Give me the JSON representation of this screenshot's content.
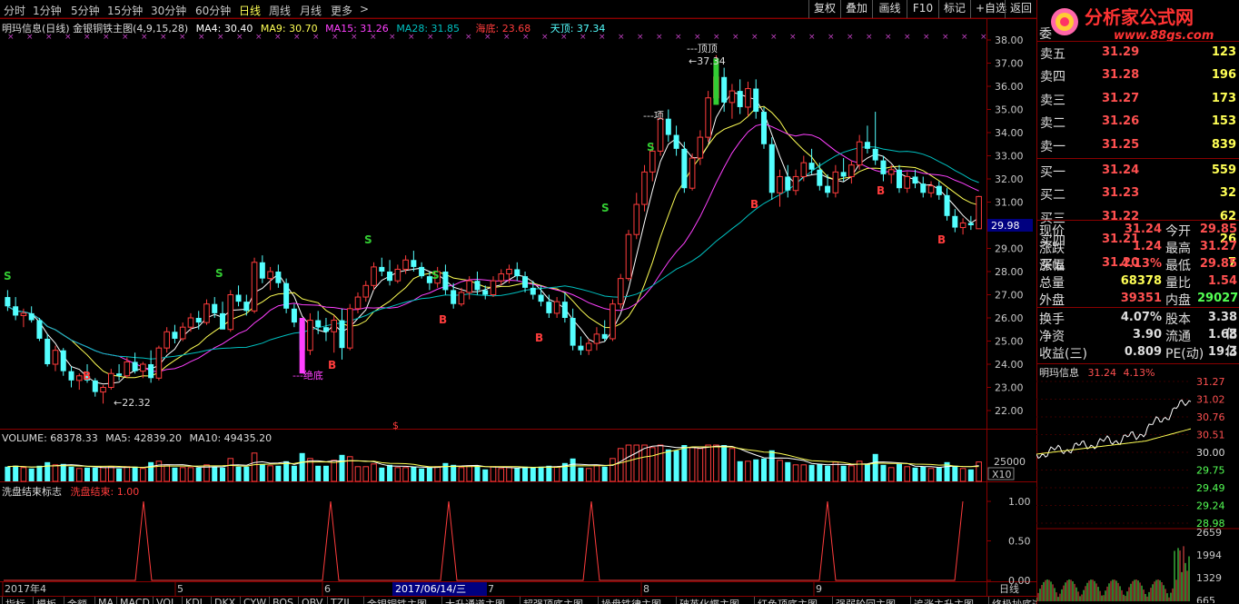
{
  "toolbar": {
    "periods": [
      "分时",
      "1分钟",
      "5分钟",
      "15分钟",
      "30分钟",
      "60分钟",
      "日线",
      "周线",
      "月线",
      "更多",
      ">"
    ],
    "active_period": "日线",
    "tools": [
      "复权",
      "叠加",
      "画线",
      "F10",
      "标记",
      "+自选",
      "返回"
    ]
  },
  "main_info": {
    "title": "明玛信息(日线) 金银铜铁主图(4,9,15,28)",
    "ma4": "MA4: 30.40",
    "ma9": "MA9: 30.70",
    "ma15": "MA15: 31.26",
    "ma28": "MA28: 31.85",
    "haidi": "海底: 23.68",
    "tianding": "天顶: 37.34"
  },
  "colors": {
    "up": "#ff3c3c",
    "down": "#54ffff",
    "ma4": "#ffffff",
    "ma9": "#ffff55",
    "ma15": "#ff40ff",
    "ma28": "#00c0c0",
    "grid": "#8a0000"
  },
  "price_axis": {
    "ticks": [
      "38.00",
      "37.00",
      "36.00",
      "35.00",
      "34.00",
      "33.00",
      "32.00",
      "31.00",
      "30.00",
      "29.00",
      "28.00",
      "27.00",
      "26.00",
      "25.00",
      "24.00",
      "23.00",
      "22.00"
    ],
    "current_tag": "29.98"
  },
  "annotations": {
    "low_price": "←22.32",
    "high_price": "←37.34",
    "ding_top": "---项",
    "ding_mid": "---项",
    "ding_high": "---顶顶",
    "jue_di": "---绝底",
    "s_label": "S",
    "b_label": "B",
    "dollar": "$"
  },
  "volume_info": {
    "title": "VOLUME: 68378.33",
    "ma5": "MA5: 42839.20",
    "ma10": "MA10: 49435.20",
    "axis_label": "25000",
    "unit": "X10"
  },
  "indicator_info": {
    "title": "洗盘结束标志",
    "value": "洗盘结束: 1.00",
    "ticks": [
      "1.00",
      "0.50",
      "0.00"
    ]
  },
  "date_axis": {
    "labels": [
      "2017年4",
      "5",
      "6",
      "7",
      "8",
      "9"
    ],
    "cursor_date": "2017/06/14/三",
    "period_label": "日线"
  },
  "bottom_tabs": [
    "指标",
    "模板",
    "金额",
    "MA",
    "MACD",
    "VOL",
    "KDJ",
    "DKX",
    "CYW",
    "BOS",
    "OBV",
    "TZJL",
    "金银铜铁主图",
    "大升通道主图",
    "超强顶底主图",
    "操盘铁律主图",
    "破茧化蝶主图",
    "红色顶底主图",
    "强弱轮回主图",
    "追涨主升主图",
    "终极抄底逃顶"
  ],
  "order_book": {
    "sell": [
      {
        "label": "卖五",
        "price": "31.29",
        "vol": "123"
      },
      {
        "label": "卖四",
        "price": "31.28",
        "vol": "196"
      },
      {
        "label": "卖三",
        "price": "31.27",
        "vol": "173"
      },
      {
        "label": "卖二",
        "price": "31.26",
        "vol": "153"
      },
      {
        "label": "卖一",
        "price": "31.25",
        "vol": "839"
      }
    ],
    "buy": [
      {
        "label": "买一",
        "price": "31.24",
        "vol": "559"
      },
      {
        "label": "买二",
        "price": "31.23",
        "vol": "32"
      },
      {
        "label": "买三",
        "price": "31.22",
        "vol": "62"
      },
      {
        "label": "买四",
        "price": "31.21",
        "vol": "26"
      },
      {
        "label": "买五",
        "price": "31.20",
        "vol": "7"
      }
    ],
    "header": "委"
  },
  "quote": {
    "rows": [
      {
        "l1": "现价",
        "v1": "31.24",
        "l2": "今开",
        "v2": "29.85",
        "c1": "#ff5050",
        "c2": "#ff5050"
      },
      {
        "l1": "涨跌",
        "v1": "1.24",
        "l2": "最高",
        "v2": "31.27",
        "c1": "#ff5050",
        "c2": "#ff5050"
      },
      {
        "l1": "涨幅",
        "v1": "4.13%",
        "l2": "最低",
        "v2": "29.85",
        "c1": "#ff5050",
        "c2": "#ff5050"
      },
      {
        "l1": "总量",
        "v1": "68378",
        "l2": "量比",
        "v2": "1.54",
        "c1": "#ffff55",
        "c2": "#ff5050"
      },
      {
        "l1": "外盘",
        "v1": "39351",
        "l2": "内盘",
        "v2": "29027",
        "c1": "#ff5050",
        "c2": "#54ff54"
      }
    ],
    "rows2": [
      {
        "l1": "换手",
        "v1": "4.07%",
        "l2": "股本",
        "v2": "3.38亿"
      },
      {
        "l1": "净资",
        "v1": "3.90",
        "l2": "流通",
        "v2": "1.68亿"
      },
      {
        "l1": "收益(三)",
        "v1": "0.809",
        "l2": "PE(动)",
        "v2": "19.3"
      }
    ]
  },
  "mini_chart": {
    "title": "明玛信息",
    "price": "31.24",
    "pct": "4.13%",
    "ticks": [
      "31.27",
      "31.02",
      "30.76",
      "30.51",
      "30.00",
      "29.75",
      "29.49",
      "29.24",
      "28.98"
    ],
    "vol_ticks": [
      "2659",
      "1994",
      "1329",
      "665"
    ]
  },
  "logo": {
    "cn": "分析家公式网",
    "url": "www.88gs.com"
  },
  "chart_data": {
    "type": "candlestick",
    "title": "明玛信息(日线) 金银铜铁主图(4,9,15,28)",
    "ylim": [
      21.5,
      38.5
    ],
    "x_labels": [
      "2017年4",
      "5",
      "6",
      "7",
      "8",
      "9"
    ],
    "ohlc": [
      [
        26.9,
        27.2,
        26.3,
        26.5
      ],
      [
        26.5,
        26.9,
        25.9,
        26.1
      ],
      [
        26.1,
        26.4,
        25.6,
        26.2
      ],
      [
        26.2,
        26.5,
        25.8,
        25.9
      ],
      [
        25.9,
        26.0,
        25.0,
        25.1
      ],
      [
        25.1,
        25.3,
        23.9,
        24.0
      ],
      [
        24.0,
        24.8,
        23.7,
        24.6
      ],
      [
        24.6,
        24.7,
        23.5,
        23.7
      ],
      [
        23.7,
        23.9,
        23.0,
        23.3
      ],
      [
        23.3,
        23.6,
        22.9,
        23.5
      ],
      [
        23.5,
        24.0,
        23.2,
        23.3
      ],
      [
        23.3,
        23.4,
        22.6,
        22.8
      ],
      [
        22.8,
        23.1,
        22.3,
        23.0
      ],
      [
        23.0,
        23.8,
        22.9,
        23.6
      ],
      [
        23.6,
        24.0,
        23.3,
        23.5
      ],
      [
        23.5,
        24.3,
        23.4,
        24.1
      ],
      [
        24.1,
        24.5,
        23.6,
        23.7
      ],
      [
        23.7,
        24.1,
        23.4,
        24.0
      ],
      [
        24.0,
        24.6,
        23.2,
        23.4
      ],
      [
        23.4,
        24.8,
        23.3,
        24.7
      ],
      [
        24.7,
        25.6,
        24.5,
        25.4
      ],
      [
        25.4,
        25.7,
        24.9,
        25.1
      ],
      [
        25.1,
        25.8,
        25.0,
        25.6
      ],
      [
        25.6,
        26.2,
        25.4,
        26.0
      ],
      [
        26.0,
        26.3,
        25.5,
        25.8
      ],
      [
        25.8,
        26.8,
        25.7,
        26.6
      ],
      [
        26.6,
        26.9,
        26.0,
        26.2
      ],
      [
        26.2,
        26.7,
        25.9,
        25.5
      ],
      [
        25.5,
        27.2,
        25.4,
        27.0
      ],
      [
        27.0,
        27.4,
        26.5,
        26.7
      ],
      [
        26.7,
        27.0,
        26.1,
        26.3
      ],
      [
        26.3,
        28.6,
        26.2,
        28.4
      ],
      [
        28.4,
        28.7,
        27.5,
        27.7
      ],
      [
        27.7,
        28.2,
        27.2,
        28.0
      ],
      [
        28.0,
        28.3,
        27.3,
        27.5
      ],
      [
        27.5,
        27.7,
        26.2,
        26.4
      ],
      [
        26.4,
        26.6,
        25.6,
        25.8
      ],
      [
        25.8,
        26.0,
        23.6,
        24.6
      ],
      [
        24.6,
        26.2,
        24.4,
        25.9
      ],
      [
        25.9,
        26.3,
        25.3,
        25.6
      ],
      [
        25.6,
        26.0,
        25.0,
        25.4
      ],
      [
        25.4,
        26.1,
        24.5,
        25.9
      ],
      [
        25.9,
        26.4,
        24.2,
        24.7
      ],
      [
        24.7,
        26.6,
        24.6,
        26.4
      ],
      [
        26.4,
        27.1,
        26.2,
        26.9
      ],
      [
        26.9,
        27.6,
        26.7,
        27.4
      ],
      [
        27.4,
        28.4,
        27.2,
        28.2
      ],
      [
        28.2,
        28.6,
        27.8,
        28.0
      ],
      [
        28.0,
        28.5,
        27.4,
        27.6
      ],
      [
        27.6,
        28.3,
        27.5,
        28.1
      ],
      [
        28.1,
        28.7,
        27.9,
        28.5
      ],
      [
        28.5,
        28.9,
        28.0,
        28.2
      ],
      [
        28.2,
        28.4,
        27.7,
        27.8
      ],
      [
        27.8,
        28.0,
        27.2,
        27.5
      ],
      [
        27.5,
        28.2,
        27.3,
        28.0
      ],
      [
        28.0,
        28.3,
        27.0,
        27.2
      ],
      [
        27.2,
        27.5,
        26.4,
        26.6
      ],
      [
        26.6,
        27.3,
        26.5,
        27.1
      ],
      [
        27.1,
        27.8,
        26.8,
        27.6
      ],
      [
        27.6,
        28.0,
        27.0,
        27.2
      ],
      [
        27.2,
        27.4,
        26.8,
        27.0
      ],
      [
        27.0,
        27.8,
        26.9,
        27.6
      ],
      [
        27.6,
        28.1,
        27.4,
        27.9
      ],
      [
        27.9,
        28.3,
        27.5,
        28.1
      ],
      [
        28.1,
        28.4,
        27.6,
        27.8
      ],
      [
        27.8,
        28.0,
        27.1,
        27.3
      ],
      [
        27.3,
        27.6,
        26.8,
        27.0
      ],
      [
        27.0,
        27.4,
        26.5,
        26.7
      ],
      [
        26.7,
        27.0,
        26.0,
        26.2
      ],
      [
        26.2,
        26.9,
        26.0,
        26.7
      ],
      [
        26.7,
        27.1,
        25.8,
        26.0
      ],
      [
        26.0,
        26.4,
        24.6,
        24.8
      ],
      [
        24.8,
        25.2,
        24.4,
        24.6
      ],
      [
        24.6,
        25.1,
        24.4,
        24.9
      ],
      [
        24.9,
        25.6,
        24.6,
        25.3
      ],
      [
        25.3,
        25.9,
        25.0,
        25.1
      ],
      [
        25.1,
        26.8,
        25.0,
        26.6
      ],
      [
        26.6,
        27.9,
        26.4,
        27.7
      ],
      [
        27.7,
        29.8,
        27.6,
        29.6
      ],
      [
        29.6,
        31.4,
        29.4,
        30.9
      ],
      [
        30.9,
        32.6,
        30.6,
        32.3
      ],
      [
        32.3,
        33.5,
        31.9,
        33.2
      ],
      [
        33.2,
        34.9,
        33.0,
        34.6
      ],
      [
        34.6,
        35.0,
        33.6,
        33.9
      ],
      [
        33.9,
        34.3,
        33.0,
        33.3
      ],
      [
        33.3,
        33.6,
        31.4,
        31.6
      ],
      [
        31.6,
        33.1,
        31.5,
        32.9
      ],
      [
        32.9,
        34.1,
        32.6,
        33.8
      ],
      [
        33.8,
        35.8,
        33.6,
        35.5
      ],
      [
        35.5,
        37.34,
        35.2,
        36.4
      ],
      [
        36.4,
        36.8,
        34.9,
        35.3
      ],
      [
        35.3,
        36.1,
        34.6,
        35.8
      ],
      [
        35.8,
        36.3,
        34.8,
        35.1
      ],
      [
        35.1,
        36.2,
        34.7,
        35.9
      ],
      [
        35.9,
        36.3,
        34.6,
        34.9
      ],
      [
        34.9,
        35.1,
        33.3,
        33.5
      ],
      [
        33.5,
        33.8,
        31.1,
        31.4
      ],
      [
        31.4,
        32.4,
        30.8,
        32.1
      ],
      [
        32.1,
        32.6,
        31.2,
        31.5
      ],
      [
        31.5,
        32.4,
        31.3,
        32.1
      ],
      [
        32.1,
        33.0,
        31.9,
        32.7
      ],
      [
        32.7,
        33.3,
        32.2,
        32.4
      ],
      [
        32.4,
        32.7,
        31.5,
        31.7
      ],
      [
        31.7,
        32.2,
        31.2,
        31.4
      ],
      [
        31.4,
        32.6,
        31.2,
        32.3
      ],
      [
        32.3,
        32.9,
        31.9,
        32.1
      ],
      [
        32.1,
        32.8,
        31.8,
        32.6
      ],
      [
        32.6,
        33.9,
        32.4,
        33.6
      ],
      [
        33.6,
        34.3,
        33.1,
        33.3
      ],
      [
        33.3,
        34.9,
        32.6,
        32.8
      ],
      [
        32.8,
        33.0,
        31.9,
        32.2
      ],
      [
        32.2,
        32.6,
        31.8,
        32.4
      ],
      [
        32.4,
        32.6,
        31.4,
        31.6
      ],
      [
        31.6,
        32.3,
        31.4,
        32.1
      ],
      [
        32.1,
        32.4,
        31.6,
        31.8
      ],
      [
        31.8,
        32.1,
        31.2,
        31.4
      ],
      [
        31.4,
        31.9,
        31.2,
        31.7
      ],
      [
        31.7,
        31.9,
        31.1,
        31.3
      ],
      [
        31.3,
        31.6,
        30.2,
        30.4
      ],
      [
        30.4,
        30.7,
        29.7,
        29.9
      ],
      [
        29.9,
        30.3,
        29.6,
        30.1
      ],
      [
        30.1,
        30.4,
        29.8,
        30.0
      ],
      [
        29.85,
        31.27,
        29.85,
        31.24
      ]
    ],
    "volume_ma5": 42839.2,
    "volume_ma10": 49435.2,
    "indicator_peaks_index": [
      5,
      36,
      52,
      67,
      91,
      113,
      127
    ]
  }
}
